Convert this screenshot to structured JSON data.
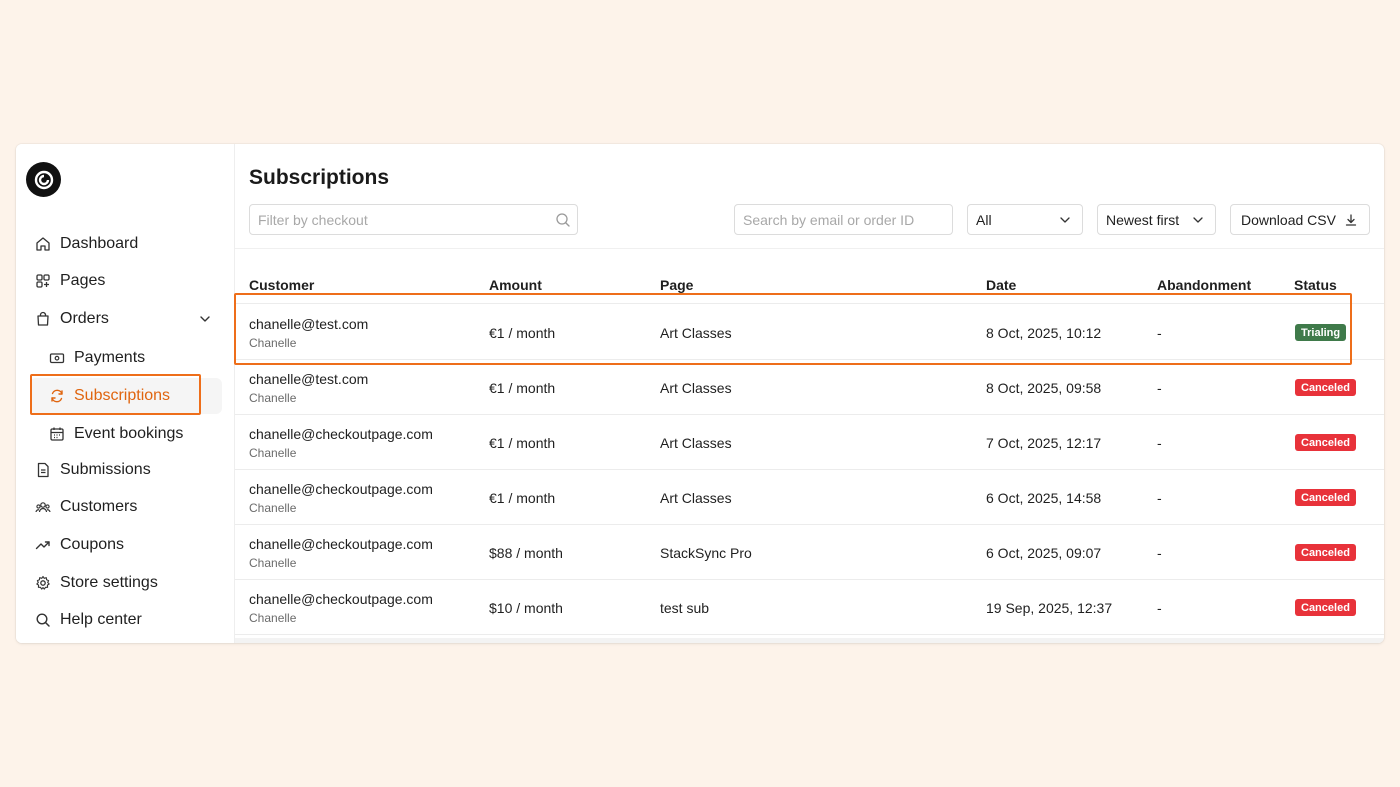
{
  "sidebar": {
    "items": [
      {
        "label": "Dashboard",
        "icon": "home-icon"
      },
      {
        "label": "Pages",
        "icon": "pages-icon"
      },
      {
        "label": "Orders",
        "icon": "bag-icon"
      },
      {
        "label": "Payments",
        "icon": "money-icon"
      },
      {
        "label": "Subscriptions",
        "icon": "refresh-icon"
      },
      {
        "label": "Event bookings",
        "icon": "calendar-icon"
      },
      {
        "label": "Submissions",
        "icon": "document-icon"
      },
      {
        "label": "Customers",
        "icon": "users-icon"
      },
      {
        "label": "Coupons",
        "icon": "trend-icon"
      },
      {
        "label": "Store settings",
        "icon": "gear-icon"
      },
      {
        "label": "Help center",
        "icon": "search-icon"
      }
    ],
    "active_item": "Subscriptions"
  },
  "header": {
    "title": "Subscriptions",
    "filter_placeholder": "Filter by checkout",
    "search_placeholder": "Search by email or order ID",
    "status_select": "All",
    "sort_select": "Newest first",
    "download_label": "Download CSV"
  },
  "table": {
    "columns": [
      "Customer",
      "Amount",
      "Page",
      "Date",
      "Abandonment",
      "Status"
    ],
    "rows": [
      {
        "email": "chanelle@test.com",
        "name": "Chanelle",
        "amount": "€1 / month",
        "page": "Art Classes",
        "date": "8 Oct, 2025, 10:12",
        "abandonment": "-",
        "status": "Trialing"
      },
      {
        "email": "chanelle@test.com",
        "name": "Chanelle",
        "amount": "€1 / month",
        "page": "Art Classes",
        "date": "8 Oct, 2025, 09:58",
        "abandonment": "-",
        "status": "Canceled"
      },
      {
        "email": "chanelle@checkoutpage.com",
        "name": "Chanelle",
        "amount": "€1 / month",
        "page": "Art Classes",
        "date": "7 Oct, 2025, 12:17",
        "abandonment": "-",
        "status": "Canceled"
      },
      {
        "email": "chanelle@checkoutpage.com",
        "name": "Chanelle",
        "amount": "€1 / month",
        "page": "Art Classes",
        "date": "6 Oct, 2025, 14:58",
        "abandonment": "-",
        "status": "Canceled"
      },
      {
        "email": "chanelle@checkoutpage.com",
        "name": "Chanelle",
        "amount": "$88 / month",
        "page": "StackSync Pro",
        "date": "6 Oct, 2025, 09:07",
        "abandonment": "-",
        "status": "Canceled"
      },
      {
        "email": "chanelle@checkoutpage.com",
        "name": "Chanelle",
        "amount": "$10 / month",
        "page": "test sub",
        "date": "19 Sep, 2025, 12:37",
        "abandonment": "-",
        "status": "Canceled"
      }
    ]
  },
  "colors": {
    "accent": "#e0650f",
    "highlight": "#ee6e1a",
    "trialing": "#3f7a4a",
    "canceled": "#e8323a",
    "background": "#fdf3ea"
  }
}
